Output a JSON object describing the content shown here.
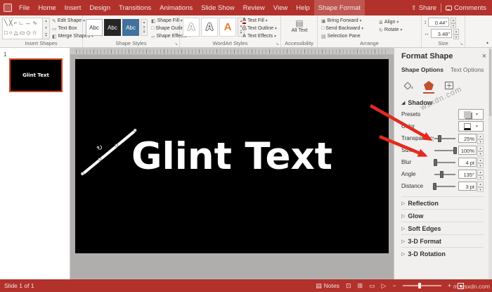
{
  "colors": {
    "ribbon_red": "#b2312b",
    "accent_orange": "#c0502f",
    "annotation_red": "#e5291d",
    "slide_bg": "#000000",
    "thumbnail_selection_border": "#d24726"
  },
  "titlebar": {
    "tabs": [
      "File",
      "Home",
      "Insert",
      "Design",
      "Transitions",
      "Animations",
      "Slide Show",
      "Review",
      "View",
      "Help",
      "Shape Format"
    ],
    "active_tab": "Shape Format",
    "share": "Share",
    "comments": "Comments"
  },
  "ribbon": {
    "insert_shapes": {
      "label": "Insert Shapes",
      "gallery_row1": "╲╳⌐∟↔∿",
      "gallery_row2": "□○△▭◇☆",
      "edit_shape": "Edit Shape",
      "text_box": "Text Box",
      "merge_shapes": "Merge Shapes"
    },
    "shape_styles": {
      "label": "Shape Styles",
      "preset_text": "Abc",
      "shape_fill": "Shape Fill",
      "shape_outline": "Shape Outline",
      "shape_effects": "Shape Effects"
    },
    "wordart_styles": {
      "label": "WordArt Styles",
      "preset_text": "A",
      "text_fill": "Text Fill",
      "text_outline": "Text Outline",
      "text_effects": "Text Effects"
    },
    "accessibility": {
      "label": "Accessibility",
      "alt_text": "Alt Text"
    },
    "arrange": {
      "label": "Arrange",
      "bring_forward": "Bring Forward",
      "send_backward": "Send Backward",
      "selection_pane": "Selection Pane",
      "align": "Align",
      "rotate": "Rotate"
    },
    "size": {
      "label": "Size",
      "height": "0.44\"",
      "width": "3.48\""
    }
  },
  "thumbnail_pane": {
    "slide_number": "1",
    "thumb_text": "Glint Text"
  },
  "slide": {
    "text": "Glint Text"
  },
  "format_pane": {
    "title": "Format Shape",
    "tab_shape_options": "Shape Options",
    "tab_text_options": "Text Options",
    "shadow_section": "Shadow",
    "presets_label": "Presets",
    "color_label": "Color",
    "transparency": {
      "label": "Transparency",
      "value": "25%",
      "pos": 25
    },
    "size": {
      "label": "Size",
      "value": "100%",
      "pos": 100
    },
    "blur": {
      "label": "Blur",
      "value": "4 pt",
      "pos": 5
    },
    "angle": {
      "label": "Angle",
      "value": "135°",
      "pos": 37
    },
    "distance": {
      "label": "Distance",
      "value": "3 pt",
      "pos": 3
    },
    "sections": [
      "Reflection",
      "Glow",
      "Soft Edges",
      "3-D Format",
      "3-D Rotation"
    ]
  },
  "statusbar": {
    "slide_indicator": "Slide 1 of 1",
    "notes": "Notes"
  },
  "watermark": {
    "diagonal": "wsxdn.com",
    "corner": "m.wsxdn.com"
  }
}
